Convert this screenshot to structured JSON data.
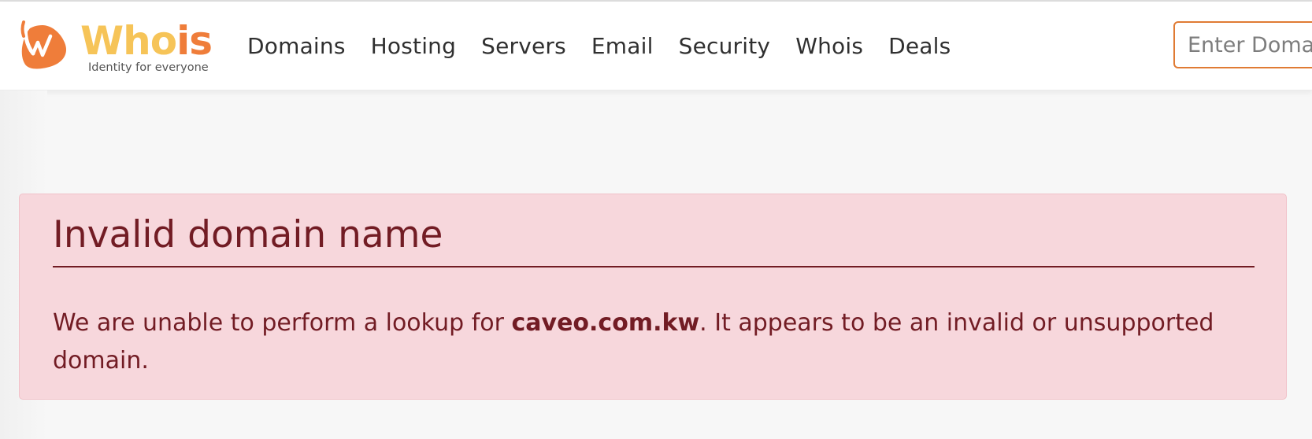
{
  "header": {
    "logo": {
      "word_main": "Who",
      "word_accent": "is",
      "tagline": "Identity for everyone"
    },
    "nav": [
      "Domains",
      "Hosting",
      "Servers",
      "Email",
      "Security",
      "Whois",
      "Deals"
    ],
    "search": {
      "placeholder": "Enter Domain",
      "value": ""
    }
  },
  "alert": {
    "title": "Invalid domain name",
    "message_before": "We are unable to perform a lookup for ",
    "domain": "caveo.com.kw",
    "message_after": ". It appears to be an invalid or unsupported domain."
  },
  "colors": {
    "brand_orange": "#ef7d3a",
    "brand_yellow": "#f6c458",
    "alert_background": "#f7d7dc",
    "alert_border": "#f1c2c9",
    "alert_text": "#721c24",
    "search_border": "#e07b34"
  },
  "icons": {
    "logo_mark": "whois-w-logo-icon"
  }
}
